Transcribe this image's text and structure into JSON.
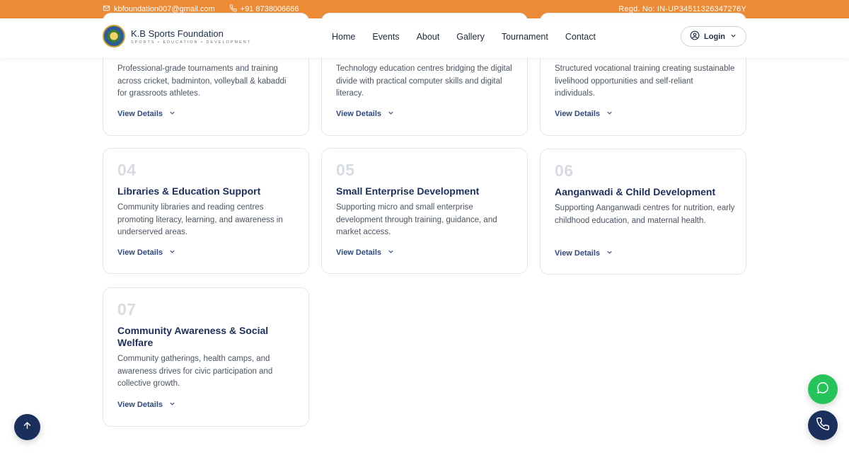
{
  "topbar": {
    "email": "kbfoundation007@gmail.com",
    "phone": "+91 8738006666",
    "regd": "Regd. No: IN-UP34511326347276Y",
    "email_icon": "mail-icon",
    "phone_icon": "phone-icon"
  },
  "header": {
    "brand_name": "K.B Sports Foundation",
    "brand_tagline": "SPORTS • EDUCATION • DEVELOPMENT",
    "nav": [
      "Home",
      "Events",
      "About",
      "Gallery",
      "Tournament",
      "Contact"
    ],
    "login_label": "Login"
  },
  "cards": [
    {
      "num": "",
      "title": "",
      "desc": "Professional-grade tournaments and training across cricket, badminton, volleyball & kabaddi for grassroots athletes.",
      "details": "View Details"
    },
    {
      "num": "",
      "title": "",
      "desc": "Technology education centres bridging the digital divide with practical computer skills and digital literacy.",
      "details": "View Details"
    },
    {
      "num": "",
      "title": "",
      "desc": "Structured vocational training creating sustainable livelihood opportunities and self-reliant individuals.",
      "details": "View Details"
    },
    {
      "num": "04",
      "title": "Libraries & Education Support",
      "desc": "Community libraries and reading centres promoting literacy, learning, and awareness in underserved areas.",
      "details": "View Details"
    },
    {
      "num": "05",
      "title": "Small Enterprise Development",
      "desc": "Supporting micro and small enterprise development through training, guidance, and market access.",
      "details": "View Details"
    },
    {
      "num": "06",
      "title": "Aanganwadi & Child Development",
      "desc": "Supporting Aanganwadi centres for nutrition, early childhood education, and maternal health.",
      "details": "View Details"
    },
    {
      "num": "07",
      "title": "Community Awareness & Social Welfare",
      "desc": "Community gatherings, health camps, and awareness drives for civic participation and collective growth.",
      "details": "View Details"
    }
  ],
  "colors": {
    "accent_orange": "#ec8a36",
    "navy": "#1b2f5c",
    "whatsapp_green": "#25c35a",
    "dark_navy_button": "#1b2f5c"
  },
  "fabs": {
    "scroll_top_icon": "arrow-up-icon",
    "whatsapp_icon": "whatsapp-icon",
    "call_icon": "phone-icon"
  }
}
